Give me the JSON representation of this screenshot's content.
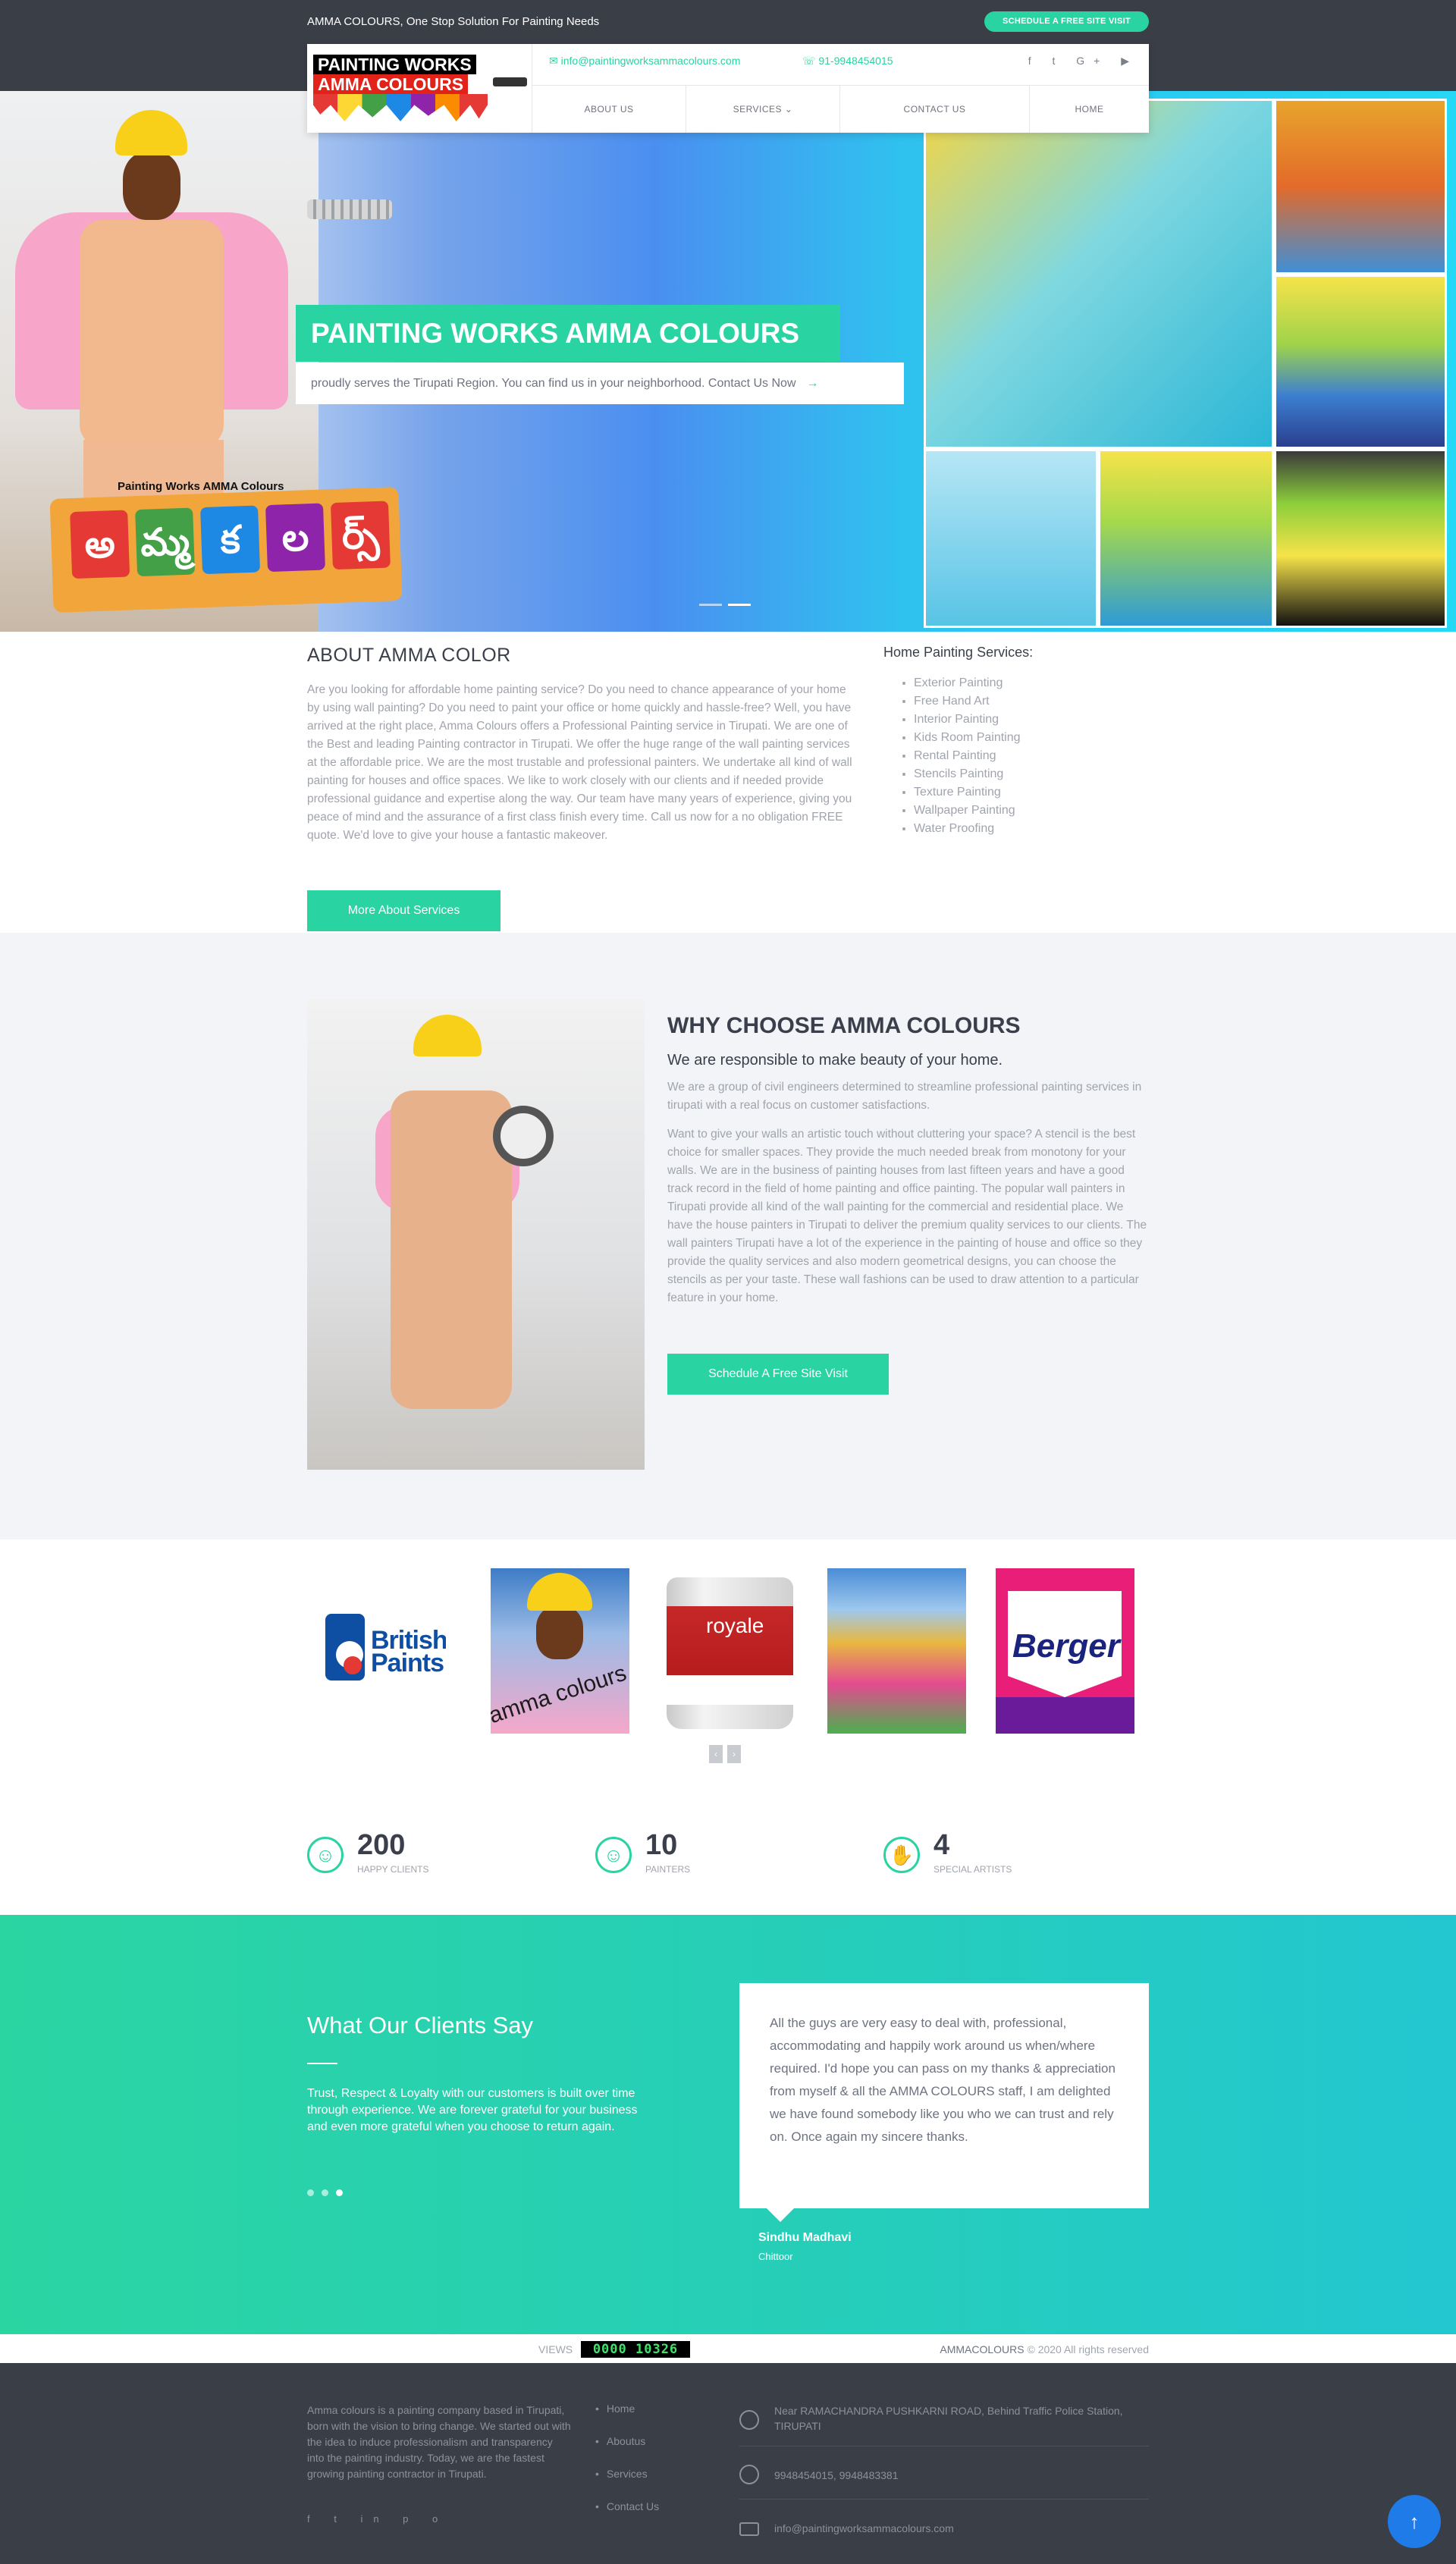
{
  "topbar": {
    "tagline": "AMMA COLOURS, One Stop Solution For Painting Needs",
    "cta": "SCHEDULE A FREE SITE VISIT"
  },
  "logo": {
    "line1": "PAINTING WORKS",
    "line2": "AMMA COLOURS"
  },
  "contact": {
    "email": "info@paintingworksammacolours.com",
    "phone": "91-9948454015",
    "social": "f  t  G+  ▶"
  },
  "nav": {
    "items": [
      "ABOUT US",
      "SERVICES ⌄",
      "CONTACT US",
      "HOME"
    ]
  },
  "hero": {
    "title": "PAINTING WORKS AMMA COLOURS",
    "subtitle": "proudly serves the Tirupati Region. You can find us in your neighborhood. Contact Us Now",
    "sign_label": "Painting Works AMMA Colours",
    "sign_letters": [
      "అ",
      "మ్మ",
      "క",
      "ల",
      "ర్స్"
    ]
  },
  "about": {
    "title": "ABOUT AMMA COLOR",
    "body": "Are you looking for affordable home painting service? Do you need to chance appearance of your home by using wall painting? Do you need to paint your office or home quickly and hassle-free? Well, you have arrived at the right place, Amma Colours offers a Professional Painting service in Tirupati. We are one of the Best and leading Painting contractor in Tirupati. We offer the huge range of the wall painting services at the affordable price. We are the most trustable and professional painters. We undertake all kind of wall painting for houses and office spaces. We like to work closely with our clients and if needed provide professional guidance and expertise along the way. Our team have many years of experience, giving you peace of mind and the assurance of a first class finish every time. Call us now for a no obligation FREE quote. We'd love to give your house a fantastic makeover.",
    "button": "More About Services"
  },
  "services": {
    "title": "Home Painting Services:",
    "items": [
      "Exterior Painting",
      "Free Hand Art",
      "Interior Painting",
      "Kids Room Painting",
      "Rental Painting",
      "Stencils Painting",
      "Texture Painting",
      "Wallpaper Painting",
      "Water Proofing"
    ]
  },
  "why": {
    "title": "WHY CHOOSE AMMA COLOURS",
    "subtitle": "We are responsible to make beauty of your home.",
    "p1": "We are a group of civil engineers determined to streamline professional painting services in tirupati with a real focus on customer satisfactions.",
    "p2": "Want to give your walls an artistic touch without cluttering your space? A stencil is the best choice for smaller spaces. They provide the much needed break from monotony for your walls. We are in the business of painting houses from last fifteen years and have a good track record in the field of home painting and office painting. The popular wall painters in Tirupati provide all kind of the wall painting for the commercial and residential place. We have the house painters in Tirupati to deliver the premium quality services to our clients. The wall painters Tirupati have a lot of the experience in the painting of house and office so they provide the quality services and also modern geometrical designs, you can choose the stencils as per your taste. These wall fashions can be used to draw attention to a particular feature in your home.",
    "button": "Schedule A Free Site Visit"
  },
  "brands": {
    "british": "British Paints",
    "amma": "amma colours",
    "royale": "royale",
    "berger": "Berger",
    "arrows": [
      "‹",
      "›"
    ]
  },
  "counters": [
    {
      "num": "200",
      "label": "HAPPY CLIENTS",
      "icon": "☺"
    },
    {
      "num": "10",
      "label": "PAINTERS",
      "icon": "☺"
    },
    {
      "num": "4",
      "label": "SPECIAL ARTISTS",
      "icon": "✋"
    }
  ],
  "testimonials": {
    "title": "What Our Clients Say",
    "intro": "Trust, Respect & Loyalty with our customers is built over time through experience. We are forever grateful for your business and even more grateful when you choose to return again.",
    "quote": "All the guys are very easy to deal with, professional, accommodating and happily work around us when/where required. I'd hope you can pass on my thanks & appreciation from myself & all the AMMA COLOURS staff, I am delighted we have found somebody like you who we can trust and rely on. Once again my sincere thanks.",
    "name": "Sindhu Madhavi",
    "location": "Chittoor"
  },
  "views": {
    "label": "VIEWS",
    "count": "0000 10326",
    "brand": "AMMACOLOURS",
    "copyright": " © 2020 All rights reserved"
  },
  "footer": {
    "about": "Amma colours is a painting company based in Tirupati, born with the vision to bring change. We started out with the idea to induce professionalism and transparency into the painting industry. Today, we are the fastest growing painting contractor in Tirupati.",
    "social": "f  t  in  p  o",
    "links": [
      "Home",
      "Aboutus",
      "Services",
      "Contact Us"
    ],
    "address": "Near RAMACHANDRA PUSHKARNI ROAD, Behind Traffic Police Station, TIRUPATI",
    "phones": "9948454015, 9948483381",
    "email": "info@paintingworksammacolours.com",
    "up": "↑"
  },
  "colors": {
    "accent": "#2ad3a2",
    "dark": "#3a3e47",
    "button_blue": "#1e7be8"
  }
}
